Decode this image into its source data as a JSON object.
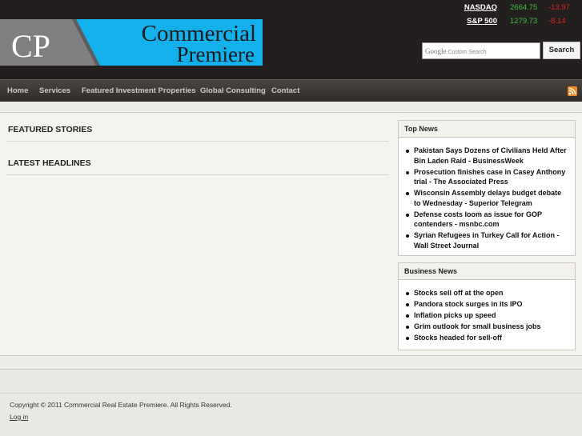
{
  "logo": {
    "initials": "CP",
    "line1": "Commercial",
    "line2": "Premiere",
    "colors": {
      "gray": "#808080",
      "blue": "#13b1ec",
      "dark": "#1a1a1a"
    }
  },
  "ticker": [
    {
      "name": "NASDAQ",
      "value": "2664.75",
      "change": "-13.97"
    },
    {
      "name": "S&P 500",
      "value": "1279.73",
      "change": "-8.14"
    }
  ],
  "search": {
    "brand": "Google",
    "placeholder": "Custom Search",
    "button_label": "Search"
  },
  "nav": {
    "items": [
      "Home",
      "Services",
      "Featured Investment Properties",
      "Global Consulting",
      "Contact"
    ]
  },
  "main": {
    "featured_title": "FEATURED STORIES",
    "headlines_title": "LATEST HEADLINES"
  },
  "sidebar": {
    "top_news": {
      "title": "Top News",
      "items": [
        "Pakistan Says Dozens of Civilians Held After Bin Laden Raid - BusinessWeek",
        "Prosecution finishes case in Casey Anthony trial - The Associated Press",
        "Wisconsin Assembly delays budget debate to Wednesday - Superior Telegram",
        "Defense costs loom as issue for GOP contenders - msnbc.com",
        "Syrian Refugees in Turkey Call for Action - Wall Street Journal"
      ]
    },
    "business_news": {
      "title": "Business News",
      "items": [
        "Stocks sell off at the open",
        "Pandora stock surges in its IPO",
        "Inflation picks up speed",
        "Grim outlook for small business jobs",
        "Stocks headed for sell-off"
      ]
    }
  },
  "footer": {
    "copyright": "Copyright © 2011 Commercial Real Estate Premiere. All Rights Reserved.",
    "login": "Log in"
  },
  "colors": {
    "header_bg": "#231f1e",
    "ticker_up": "#35c23a",
    "ticker_down": "#e4261f",
    "rss": "#f08a24"
  }
}
